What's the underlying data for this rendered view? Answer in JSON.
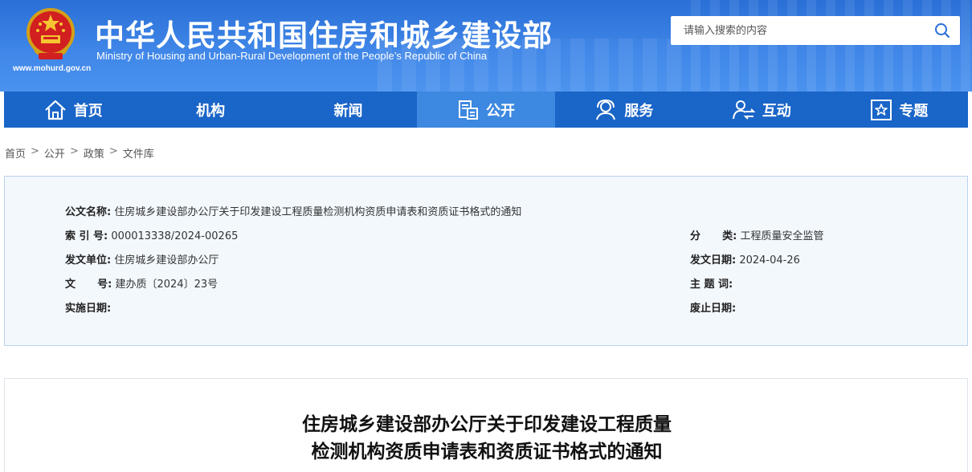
{
  "header": {
    "title_cn": "中华人民共和国住房和城乡建设部",
    "title_en": "Ministry of Housing and Urban-Rural Development of the People’s Republic of China",
    "site_url": "www.mohurd.gov.cn",
    "search_placeholder": "请输入搜索的内容"
  },
  "nav": {
    "items": [
      {
        "label": "首页",
        "icon": "home-icon"
      },
      {
        "label": "机构",
        "icon": ""
      },
      {
        "label": "新闻",
        "icon": ""
      },
      {
        "label": "公开",
        "icon": "document-icon",
        "active": true
      },
      {
        "label": "服务",
        "icon": "service-icon"
      },
      {
        "label": "互动",
        "icon": "interaction-icon"
      },
      {
        "label": "专题",
        "icon": "topic-icon"
      }
    ]
  },
  "breadcrumb": [
    "首页",
    "公开",
    "政策",
    "文件库"
  ],
  "breadcrumb_sep": ">",
  "info": {
    "doc_name_label": "公文名称:",
    "doc_name": "住房城乡建设部办公厅关于印发建设工程质量检测机构资质申请表和资质证书格式的通知",
    "index_label": "索 引 号:",
    "index": "000013338/2024-00265",
    "category_label": "分      类:",
    "category": "工程质量安全监管",
    "issuer_label": "发文单位:",
    "issuer": "住房城乡建设部办公厅",
    "date_label": "发文日期:",
    "date": "2024-04-26",
    "doc_no_label": "文      号:",
    "doc_no": "建办质〔2024〕23号",
    "keywords_label": "主 题 词:",
    "keywords": "",
    "effective_label": "实施日期:",
    "effective": "",
    "expiry_label": "废止日期:",
    "expiry": ""
  },
  "article": {
    "title_line1": "住房城乡建设部办公厅关于印发建设工程质量",
    "title_line2": "检测机构资质申请表和资质证书格式的通知"
  },
  "colors": {
    "header_blue": "#2a6fd6",
    "nav_blue": "#1a65c8",
    "nav_active": "#3d88e0",
    "info_bg": "#f3f8fd"
  }
}
